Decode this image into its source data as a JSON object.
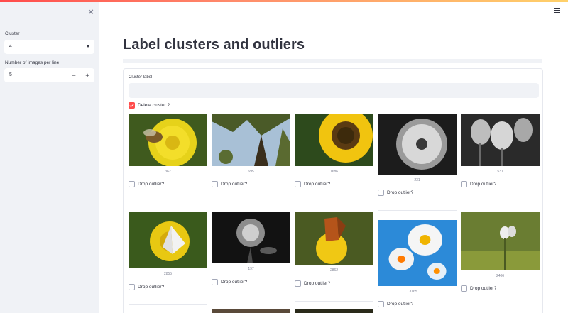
{
  "sidebar": {
    "cluster_label": "Cluster",
    "cluster_value": "4",
    "per_line_label": "Number of images per line",
    "per_line_value": "5",
    "minus": "−",
    "plus": "+",
    "close": "×"
  },
  "main": {
    "title": "Label clusters and outliers",
    "form": {
      "cluster_label_field": "Cluster label",
      "cluster_label_value": "",
      "delete_label": "Delete cluster ?",
      "delete_checked": true
    }
  },
  "images": [
    {
      "id": "362",
      "subject": "bee on yellow dandelion",
      "drop_label": "Drop outlier?"
    },
    {
      "id": "695",
      "subject": "tree branches against sky",
      "drop_label": "Drop outlier?"
    },
    {
      "id": "1686",
      "subject": "sunflower",
      "drop_label": "Drop outlier?"
    },
    {
      "id": "231",
      "subject": "dandelion seed head black and white",
      "drop_label": "Drop outlier?"
    },
    {
      "id": "531",
      "subject": "tulips black and white",
      "drop_label": "Drop outlier?"
    },
    {
      "id": "2855",
      "subject": "white butterfly on yellow flower",
      "drop_label": "Drop outlier?"
    },
    {
      "id": "197",
      "subject": "rose black and white",
      "drop_label": "Drop outlier?"
    },
    {
      "id": "2862",
      "subject": "orange butterfly on yellow flower",
      "drop_label": "Drop outlier?"
    },
    {
      "id": "3165",
      "subject": "daisies on blue background",
      "drop_label": "Drop outlier?"
    },
    {
      "id": "2406",
      "subject": "white buds in green field",
      "drop_label": "Drop outlier?"
    }
  ],
  "colors": {
    "accent": "#ff4b4b",
    "sidebar_bg": "#f0f2f6",
    "text": "#31333f",
    "caption": "#808495"
  }
}
